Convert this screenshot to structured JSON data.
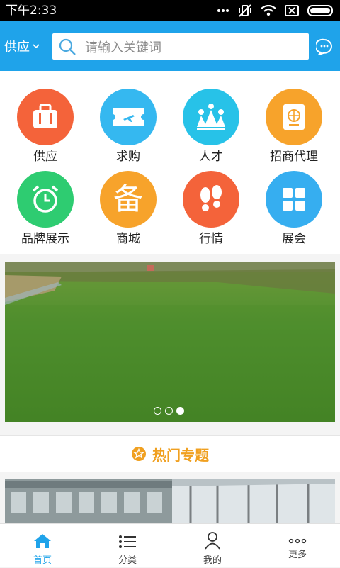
{
  "status": {
    "time": "下午2:33"
  },
  "header": {
    "city": "供应",
    "search_placeholder": "请输入关键词"
  },
  "categories": [
    {
      "label": "供应",
      "icon": "briefcase-icon",
      "color": "#f4633a"
    },
    {
      "label": "求购",
      "icon": "ticket-plane-icon",
      "color": "#35b8f0"
    },
    {
      "label": "人才",
      "icon": "crown-people-icon",
      "color": "#27c2e8"
    },
    {
      "label": "招商代理",
      "icon": "passport-icon",
      "color": "#f7a32b"
    },
    {
      "label": "品牌展示",
      "icon": "alarm-clock-icon",
      "color": "#2ecc71"
    },
    {
      "label": "商城",
      "icon": "bei-character-icon",
      "color": "#f7a32b",
      "icon_text": "备"
    },
    {
      "label": "行情",
      "icon": "footprints-icon",
      "color": "#f4633a"
    },
    {
      "label": "展会",
      "icon": "grid-icon",
      "color": "#36aef0"
    }
  ],
  "banner": {
    "slides": 3,
    "active_slide": 3
  },
  "section": {
    "title": "热门专题"
  },
  "tabbar": {
    "items": [
      {
        "label": "首页",
        "icon": "home-icon",
        "active": true
      },
      {
        "label": "分类",
        "icon": "list-icon",
        "active": false
      },
      {
        "label": "我的",
        "icon": "person-icon",
        "active": false
      },
      {
        "label": "更多",
        "icon": "more-dots-icon",
        "active": false
      }
    ]
  },
  "colors": {
    "brand": "#1fa3ea",
    "section_accent": "#f0a020"
  }
}
